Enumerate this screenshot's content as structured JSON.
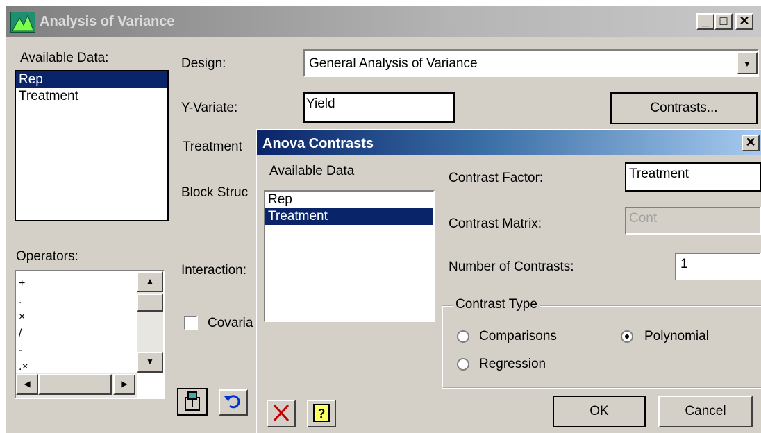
{
  "main_window": {
    "title": "Analysis of Variance",
    "controls": {
      "minimize": "_",
      "maximize": "□",
      "close": "✕"
    },
    "available_data_label": "Available Data:",
    "available_data_items": [
      "Rep",
      "Treatment"
    ],
    "operators_label": "Operators:",
    "operators_items": [
      "+",
      ".",
      "×",
      "/",
      "-",
      ".×"
    ],
    "design_label": "Design:",
    "design_value": "General Analysis of Variance",
    "yvariate_label": "Y-Variate:",
    "yvariate_value": "Yield",
    "contrasts_button": "Contrasts...",
    "treatment_label": "Treatment",
    "block_label": "Block Struc",
    "interactions_label": "Interaction:",
    "covariate_label": "Covaria"
  },
  "contrasts_dialog": {
    "title": "Anova Contrasts",
    "close": "✕",
    "available_data_label": "Available Data",
    "available_data_items": [
      "Rep",
      "Treatment"
    ],
    "contrast_factor_label": "Contrast Factor:",
    "contrast_factor_value": "Treatment",
    "contrast_matrix_label": "Contrast Matrix:",
    "contrast_matrix_placeholder": "Cont",
    "number_of_contrasts_label": "Number of Contrasts:",
    "number_of_contrasts_value": "1",
    "contrast_type_label": "Contrast Type",
    "radio_comparisons": "Comparisons",
    "radio_polynomial": "Polynomial",
    "radio_regression": "Regression",
    "ok_button": "OK",
    "cancel_button": "Cancel",
    "selected_contrast_type": "Polynomial"
  },
  "colors": {
    "selection": "#0a246a",
    "face": "#d4d0c8",
    "dialog_title": "#0a246a"
  }
}
